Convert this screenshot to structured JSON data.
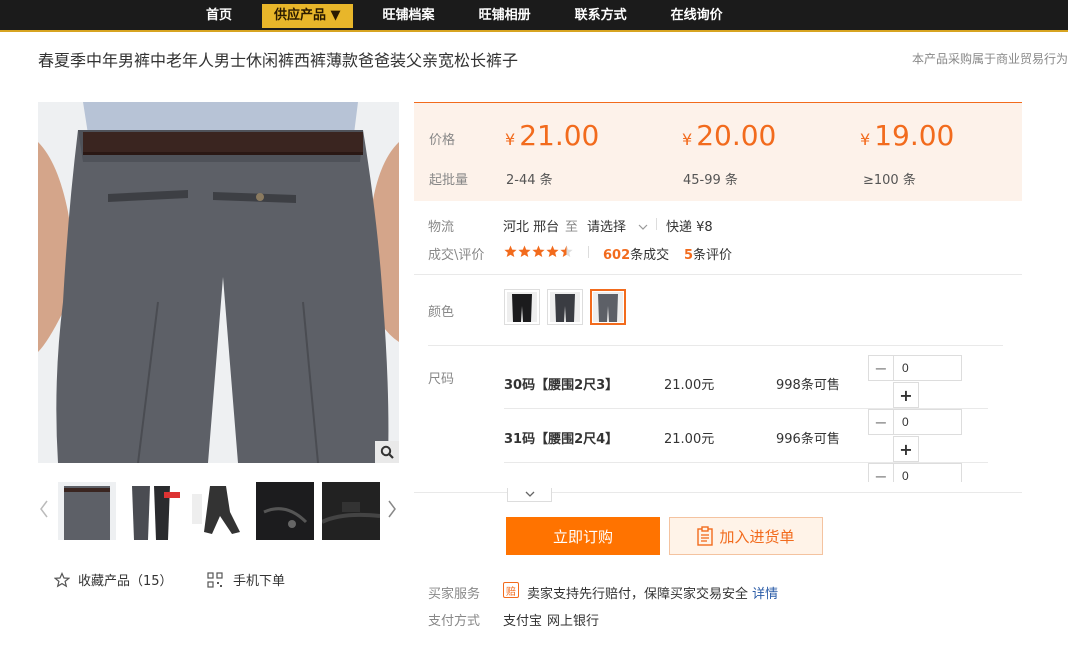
{
  "nav": {
    "items": [
      "首页",
      "供应产品 ▼",
      "旺铺档案",
      "旺铺相册",
      "联系方式",
      "在线询价"
    ],
    "active_index": 1
  },
  "product": {
    "title": "春夏季中年男裤中老年人男士休闲裤西裤薄款爸爸装父亲宽松长裤子",
    "supplier_note": "本产品采购属于商业贸易行为"
  },
  "gallery": {
    "favorite_label": "收藏产品（15）",
    "mobile_label": "手机下单"
  },
  "pricing": {
    "price_label": "价格",
    "moq_label": "起批量",
    "currency": "¥",
    "tiers": [
      {
        "price": "21.00",
        "range": "2-44 条"
      },
      {
        "price": "20.00",
        "range": "45-99 条"
      },
      {
        "price": "19.00",
        "range": "≥100 条"
      }
    ]
  },
  "logistics": {
    "label": "物流",
    "from": "河北 邢台",
    "to_word": "至",
    "destination": "请选择",
    "shipping": "快递 ¥8"
  },
  "reviews": {
    "label": "成交\\评价",
    "rating": 4.5,
    "deals_count": "602",
    "deals_suffix": "条成交",
    "review_count": "5",
    "review_suffix": "条评价"
  },
  "color": {
    "label": "颜色",
    "selected_index": 2
  },
  "sizes": {
    "label": "尺码",
    "rows": [
      {
        "name": "30码【腰围2尺3】",
        "price": "21.00元",
        "stock": "998条可售",
        "qty": "0"
      },
      {
        "name": "31码【腰围2尺4】",
        "price": "21.00元",
        "stock": "996条可售",
        "qty": "0"
      },
      {
        "name": "",
        "price": "",
        "stock": "",
        "qty": "0"
      }
    ]
  },
  "actions": {
    "buy_now": "立即订购",
    "add_to_list": "加入进货单"
  },
  "service": {
    "label": "买家服务",
    "text": "卖家支持先行赔付，保障买家交易安全",
    "link": "详情",
    "badge": "赔"
  },
  "payment": {
    "label": "支付方式",
    "methods": [
      "支付宝",
      "网上银行"
    ]
  },
  "colors": {
    "accent": "#f26b1d",
    "nav_bg": "#1b1b1b",
    "nav_active": "#e8b62a",
    "link": "#2b5ca8"
  }
}
